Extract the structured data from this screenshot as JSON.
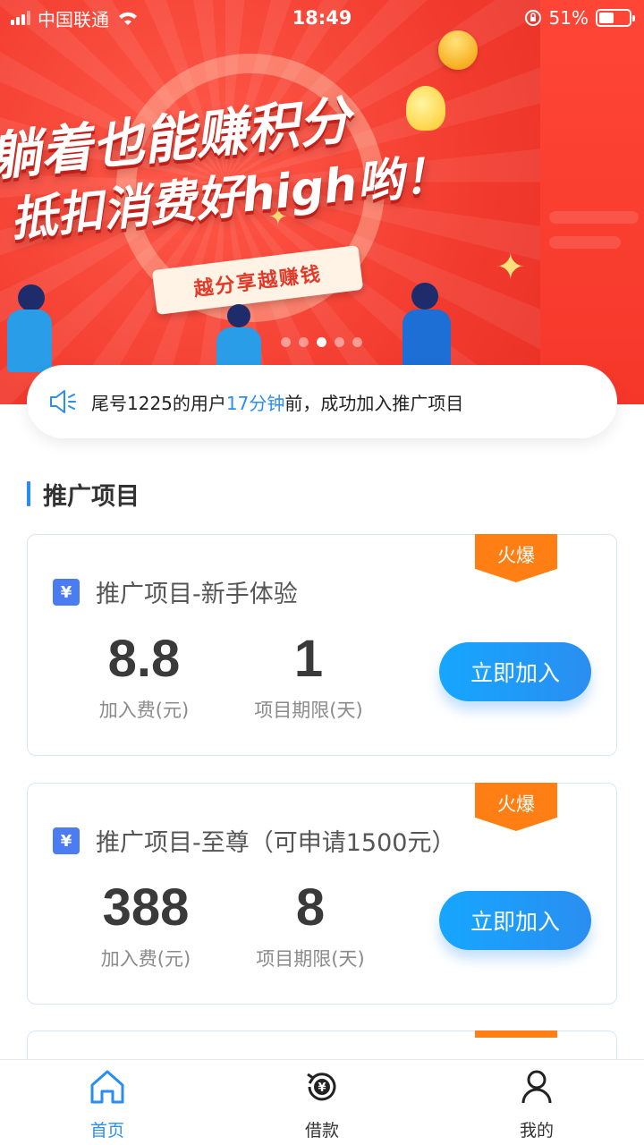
{
  "status_bar": {
    "carrier": "中国联通",
    "time": "18:49",
    "battery_percent": "51%",
    "battery_level": 0.51
  },
  "banner": {
    "headline_line1": "躺着也能赚积分",
    "headline_line2": "抵扣消费好high哟！",
    "ribbon": "越分享越赚钱",
    "slide_count": 5,
    "active_slide": 3
  },
  "notice": {
    "prefix": "尾号1225的用户",
    "highlight": "17分钟",
    "suffix": "前，成功加入推广项目",
    "icon": "speaker-icon"
  },
  "section": {
    "title": "推广项目"
  },
  "projects": [
    {
      "badge": "火爆",
      "icon": "yen-icon",
      "title": "推广项目-新手体验",
      "fee_value": "8.8",
      "fee_label": "加入费(元)",
      "term_value": "1",
      "term_label": "项目期限(天)",
      "button": "立即加入"
    },
    {
      "badge": "火爆",
      "icon": "yen-icon",
      "title": "推广项目-至尊（可申请1500元）",
      "fee_value": "388",
      "fee_label": "加入费(元)",
      "term_value": "8",
      "term_label": "项目期限(天)",
      "button": "立即加入"
    }
  ],
  "tabbar": {
    "items": [
      {
        "label": "首页",
        "icon": "home-icon",
        "active": true
      },
      {
        "label": "借款",
        "icon": "loan-icon",
        "active": false
      },
      {
        "label": "我的",
        "icon": "profile-icon",
        "active": false
      }
    ]
  },
  "colors": {
    "accent": "#2a8ef0",
    "badge": "#ff7f14",
    "banner_red": "#f23b2e"
  }
}
